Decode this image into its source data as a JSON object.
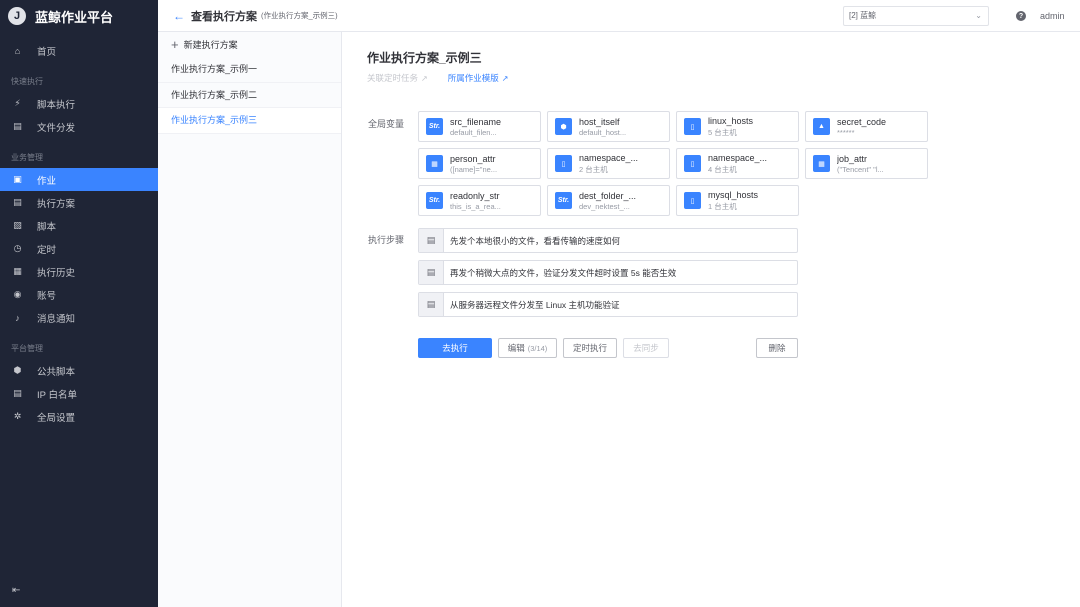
{
  "app": {
    "logo_letter": "J",
    "title": "蓝鲸作业平台"
  },
  "sidebar": {
    "home": {
      "label": "首页"
    },
    "groups": [
      {
        "title": "快速执行"
      },
      {
        "title": "业务管理"
      },
      {
        "title": "平台管理"
      }
    ],
    "items": [
      {
        "label": "脚本执行",
        "icon": "script-run-icon"
      },
      {
        "label": "文件分发",
        "icon": "file-icon"
      },
      {
        "label": "作业",
        "icon": "job-icon"
      },
      {
        "label": "执行方案",
        "icon": "plan-icon"
      },
      {
        "label": "脚本",
        "icon": "script-icon"
      },
      {
        "label": "定时",
        "icon": "clock-icon"
      },
      {
        "label": "执行历史",
        "icon": "history-icon"
      },
      {
        "label": "账号",
        "icon": "account-icon"
      },
      {
        "label": "消息通知",
        "icon": "bell-icon"
      },
      {
        "label": "公共脚本",
        "icon": "public-script-icon"
      },
      {
        "label": "IP 白名单",
        "icon": "whitelist-icon"
      },
      {
        "label": "全局设置",
        "icon": "gear-icon"
      }
    ],
    "active_index": 2
  },
  "header": {
    "title": "查看执行方案",
    "subtitle": "(作业执行方案_示例三)",
    "business_select": "[2] 蓝鲸",
    "user": "admin"
  },
  "planlist": {
    "new_label": "新建执行方案",
    "items": [
      "作业执行方案_示例一",
      "作业执行方案_示例二",
      "作业执行方案_示例三"
    ],
    "active_index": 2
  },
  "main": {
    "title": "作业执行方案_示例三",
    "link_disabled": "关联定时任务",
    "link_active": "所属作业模版",
    "vars_label": "全局变量",
    "steps_label": "执行步骤",
    "variables": [
      {
        "name": "src_filename",
        "value": "default_filen...",
        "type": "Str."
      },
      {
        "name": "host_itself",
        "value": "default_host...",
        "type": "cube"
      },
      {
        "name": "linux_hosts",
        "value": "5 台主机",
        "type": "host"
      },
      {
        "name": "secret_code",
        "value": "******",
        "type": "lock"
      },
      {
        "name": "person_attr",
        "value": "([name]=\"ne...",
        "type": "grid"
      },
      {
        "name": "namespace_...",
        "value": "2 台主机",
        "type": "host"
      },
      {
        "name": "namespace_...",
        "value": "4 台主机",
        "type": "host"
      },
      {
        "name": "job_attr",
        "value": "(\"Tencent\" \"l...",
        "type": "grid"
      },
      {
        "name": "readonly_str",
        "value": "this_is_a_rea...",
        "type": "Str."
      },
      {
        "name": "dest_folder_...",
        "value": "dev_nektest_...",
        "type": "Str."
      },
      {
        "name": "mysql_hosts",
        "value": "1 台主机",
        "type": "host"
      }
    ],
    "steps": [
      "先发个本地很小的文件，看看传输的速度如何",
      "再发个稍微大点的文件，验证分发文件超时设置 5s 能否生效",
      "从服务器远程文件分发至 Linux 主机功能验证"
    ],
    "buttons": {
      "execute": "去执行",
      "edit": "编辑",
      "edit_count": "(3/14)",
      "schedule": "定时执行",
      "sync": "去同步",
      "delete": "删除"
    }
  }
}
